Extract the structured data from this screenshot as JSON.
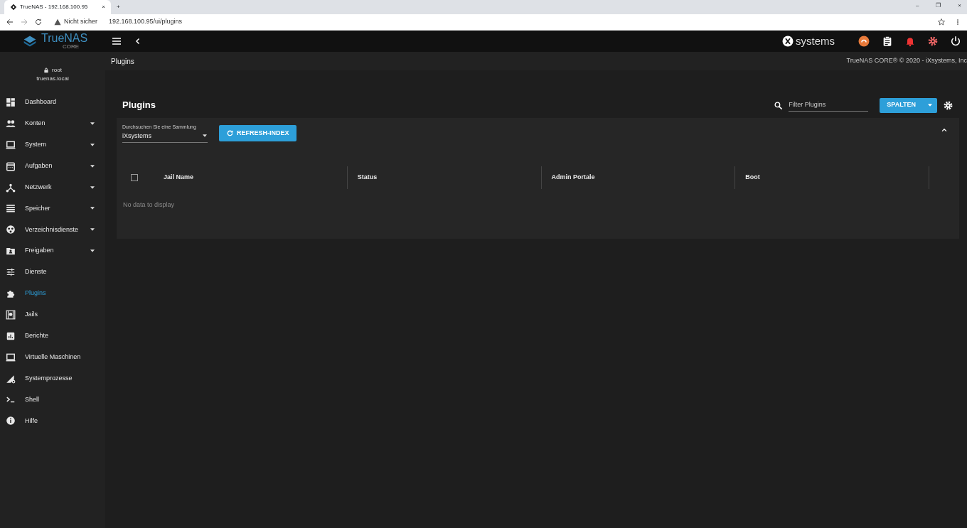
{
  "browser": {
    "tab_title": "TrueNAS - 192.168.100.95",
    "tab_close": "×",
    "new_tab": "+",
    "security": "Nicht sicher",
    "url": "192.168.100.95/ui/plugins"
  },
  "window_controls": [
    "–",
    "❐",
    "×"
  ],
  "header": {
    "logo": "TrueNAS",
    "logo_sub": "CORE",
    "vendor": "systems"
  },
  "breadcrumb": "Plugins",
  "copyright": "TrueNAS CORE® © 2020 - iXsystems, Inc",
  "user": {
    "name": "root",
    "host": "truenas.local"
  },
  "sidebar": {
    "items": [
      {
        "label": "Dashboard",
        "selected": false,
        "has_submenu": false
      },
      {
        "label": "Konten",
        "selected": false,
        "has_submenu": true
      },
      {
        "label": "System",
        "selected": false,
        "has_submenu": true
      },
      {
        "label": "Aufgaben",
        "selected": false,
        "has_submenu": true
      },
      {
        "label": "Netzwerk",
        "selected": false,
        "has_submenu": true
      },
      {
        "label": "Speicher",
        "selected": false,
        "has_submenu": true
      },
      {
        "label": "Verzeichnisdienste",
        "selected": false,
        "has_submenu": true
      },
      {
        "label": "Freigaben",
        "selected": false,
        "has_submenu": true
      },
      {
        "label": "Dienste",
        "selected": false,
        "has_submenu": false
      },
      {
        "label": "Plugins",
        "selected": true,
        "has_submenu": false
      },
      {
        "label": "Jails",
        "selected": false,
        "has_submenu": false
      },
      {
        "label": "Berichte",
        "selected": false,
        "has_submenu": false
      },
      {
        "label": "Virtuelle Maschinen",
        "selected": false,
        "has_submenu": false
      },
      {
        "label": "Systemprozesse",
        "selected": false,
        "has_submenu": false
      },
      {
        "label": "Shell",
        "selected": false,
        "has_submenu": false
      },
      {
        "label": "Hilfe",
        "selected": false,
        "has_submenu": false
      }
    ]
  },
  "card": {
    "title": "Plugins",
    "filter": {
      "placeholder": "Filter Plugins"
    },
    "columns_button": "SPALTEN",
    "collection": {
      "label": "Durchsuchen Sie eine Sammlung",
      "value": "iXsystems"
    },
    "refresh_button": "REFRESH-INDEX",
    "table": {
      "select_all": {
        "checked": false
      },
      "columns": [
        "Jail Name",
        "Status",
        "Admin Portale",
        "Boot"
      ],
      "empty_message": "No data to display"
    }
  }
}
